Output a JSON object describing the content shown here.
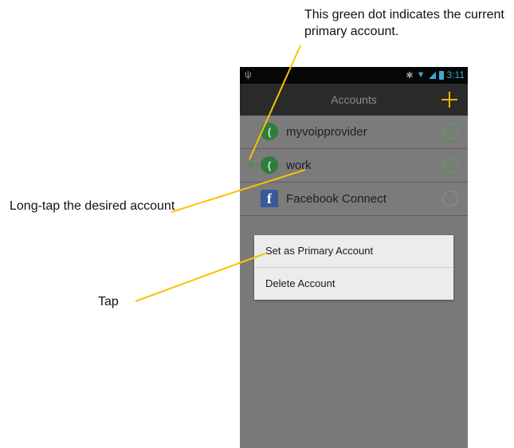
{
  "callouts": {
    "primary_dot": "This green dot indicates the current primary account.",
    "long_tap": "Long-tap the desired account",
    "tap": "Tap"
  },
  "status_bar": {
    "time": "3:11"
  },
  "action_bar": {
    "title": "Accounts"
  },
  "accounts": [
    {
      "name": "myvoipprovider",
      "icon": "voip-app-icon",
      "checked": true
    },
    {
      "name": "work",
      "icon": "voip-app-icon",
      "checked": true,
      "primary": true
    },
    {
      "name": "Facebook Connect",
      "icon": "facebook-icon",
      "checked": false
    }
  ],
  "context_menu": {
    "items": [
      "Set as Primary Account",
      "Delete Account"
    ]
  },
  "colors": {
    "accent_add": "#f2b300",
    "check_green": "#4cae4c",
    "leader_line": "#f5c400"
  }
}
